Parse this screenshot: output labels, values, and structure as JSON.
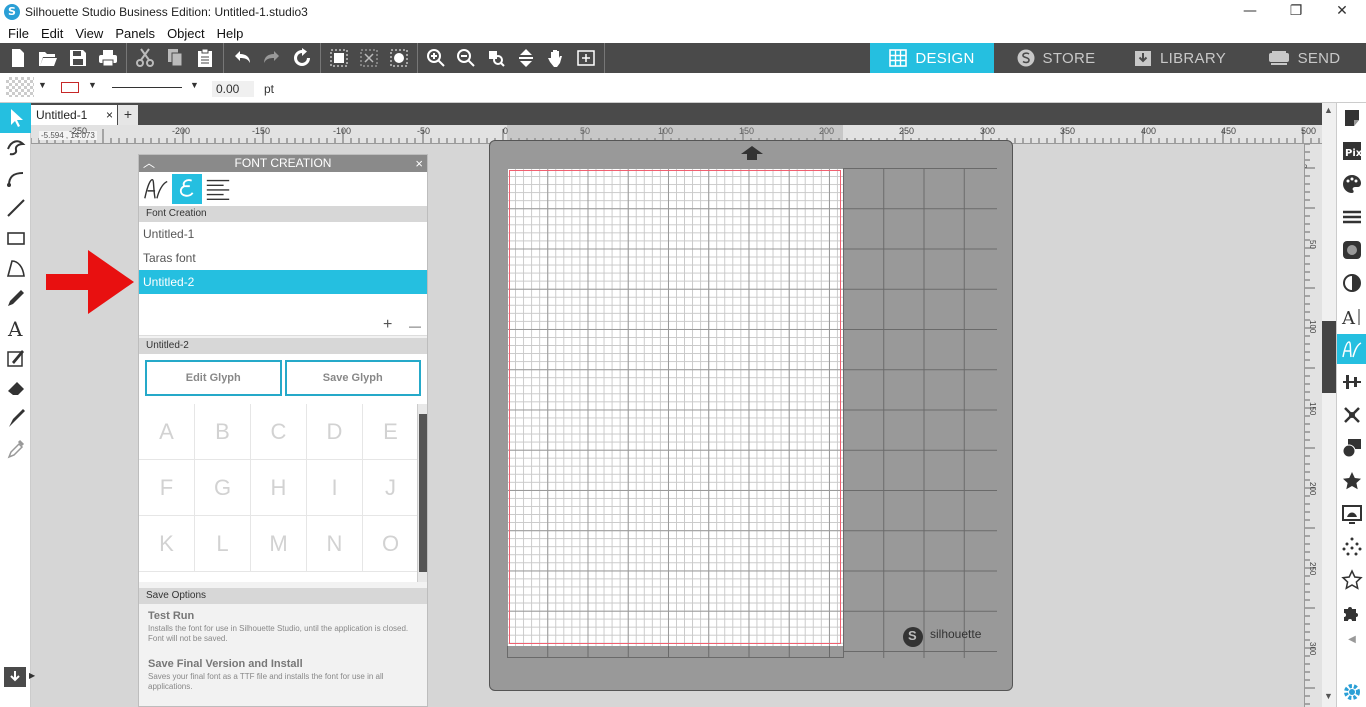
{
  "window": {
    "title": "Silhouette Studio Business Edition: Untitled-1.studio3",
    "minimize": "—",
    "restore": "❐",
    "close": "✕"
  },
  "menu": [
    "File",
    "Edit",
    "View",
    "Panels",
    "Object",
    "Help"
  ],
  "modes": [
    {
      "label": "DESIGN",
      "active": true
    },
    {
      "label": "STORE",
      "active": false
    },
    {
      "label": "LIBRARY",
      "active": false
    },
    {
      "label": "SEND",
      "active": false
    }
  ],
  "properties": {
    "line_width_value": "0.00",
    "line_width_unit": "pt"
  },
  "doc_tabs": {
    "active": "Untitled-1",
    "close": "×",
    "add": "+"
  },
  "coord_readout": "-5.594 , 14.073",
  "ruler_h_labels": [
    "-250",
    "-200",
    "-150",
    "-100",
    "-50",
    "0",
    "50",
    "100",
    "150",
    "200",
    "250",
    "300",
    "350",
    "400",
    "450",
    "500"
  ],
  "ruler_v_labels": [
    "0",
    "50",
    "100",
    "150",
    "200",
    "250",
    "300"
  ],
  "mat": {
    "brand": "silhouette"
  },
  "font_panel": {
    "title": "FONT CREATION",
    "collapse": "︿",
    "close": "×",
    "section_fonts": "Font Creation",
    "fonts": [
      "Untitled-1",
      "Taras font",
      "Untitled-2"
    ],
    "selected_font_index": 2,
    "add": "+",
    "remove": "—",
    "section_current": "Untitled-2",
    "edit_glyph": "Edit Glyph",
    "save_glyph": "Save Glyph",
    "glyphs": [
      "A",
      "B",
      "C",
      "D",
      "E",
      "F",
      "G",
      "H",
      "I",
      "J",
      "K",
      "L",
      "M",
      "N",
      "O"
    ],
    "section_save": "Save Options",
    "test_run_title": "Test Run",
    "test_run_desc": "Installs the font for use in Silhouette Studio, until the application is closed. Font will not be saved.",
    "final_title": "Save Final Version and Install",
    "final_desc": "Saves your final font as a TTF file and installs the font for use in all applications."
  },
  "colors": {
    "accent": "#25bfe0",
    "toolbar": "#4a4a4a",
    "arrow": "#e81010"
  }
}
